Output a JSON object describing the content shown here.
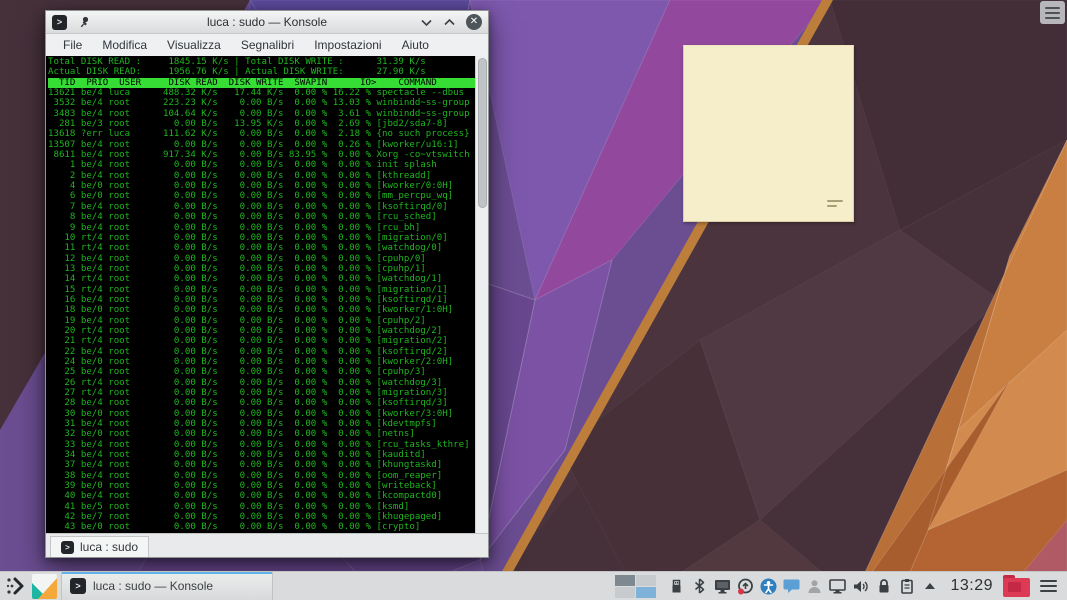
{
  "window": {
    "title": "luca : sudo — Konsole",
    "menu": [
      "File",
      "Modifica",
      "Visualizza",
      "Segnalibri",
      "Impostazioni",
      "Aiuto"
    ],
    "tab_label": "luca : sudo",
    "titlebar_icons": [
      "konsole-icon",
      "pin-icon",
      "minimize-chevron-icon",
      "maximize-chevron-icon",
      "close-icon"
    ],
    "prompt_glyph": ">"
  },
  "terminal": {
    "colors": {
      "background": "#000000",
      "text_green": "#1fb51f",
      "header_bg": "#35dd35",
      "header_text": "#000000"
    },
    "summary_lines": [
      "Total DISK READ :     1845.15 K/s | Total DISK WRITE :      31.39 K/s",
      "Actual DISK READ:     1956.76 K/s | Actual DISK WRITE:      27.90 K/s"
    ],
    "header": "  TID  PRIO  USER     DISK READ  DISK WRITE  SWAPIN      IO>    COMMAND",
    "columns": [
      "TID",
      "PRIO",
      "USER",
      "DISK READ",
      "DISK WRITE",
      "SWAPIN",
      "IO>",
      "COMMAND"
    ],
    "processes": [
      [
        "13621",
        "be/4",
        "luca",
        "488.32 K/s",
        "17.44 K/s",
        "0.00 %",
        "16.22 %",
        "spectacle --dbus"
      ],
      [
        "3532",
        "be/4",
        "root",
        "223.23 K/s",
        "0.00 B/s",
        "0.00 %",
        "13.03 %",
        "winbindd~ss-group"
      ],
      [
        "3483",
        "be/4",
        "root",
        "104.64 K/s",
        "0.00 B/s",
        "0.00 %",
        "3.61 %",
        "winbindd~ss-group"
      ],
      [
        "281",
        "be/3",
        "root",
        "0.00 B/s",
        "13.95 K/s",
        "0.00 %",
        "2.69 %",
        "[jbd2/sda7-8]"
      ],
      [
        "13618",
        "?err",
        "luca",
        "111.62 K/s",
        "0.00 B/s",
        "0.00 %",
        "2.18 %",
        "{no such process}"
      ],
      [
        "13507",
        "be/4",
        "root",
        "0.00 B/s",
        "0.00 B/s",
        "0.00 %",
        "0.26 %",
        "[kworker/u16:1]"
      ],
      [
        "8611",
        "be/4",
        "root",
        "917.34 K/s",
        "0.00 B/s",
        "83.95 %",
        "0.00 %",
        "Xorg -co~vtswitch"
      ],
      [
        "1",
        "be/4",
        "root",
        "0.00 B/s",
        "0.00 B/s",
        "0.00 %",
        "0.00 %",
        "init splash"
      ],
      [
        "2",
        "be/4",
        "root",
        "0.00 B/s",
        "0.00 B/s",
        "0.00 %",
        "0.00 %",
        "[kthreadd]"
      ],
      [
        "4",
        "be/0",
        "root",
        "0.00 B/s",
        "0.00 B/s",
        "0.00 %",
        "0.00 %",
        "[kworker/0:0H]"
      ],
      [
        "6",
        "be/0",
        "root",
        "0.00 B/s",
        "0.00 B/s",
        "0.00 %",
        "0.00 %",
        "[mm_percpu_wq]"
      ],
      [
        "7",
        "be/4",
        "root",
        "0.00 B/s",
        "0.00 B/s",
        "0.00 %",
        "0.00 %",
        "[ksoftirqd/0]"
      ],
      [
        "8",
        "be/4",
        "root",
        "0.00 B/s",
        "0.00 B/s",
        "0.00 %",
        "0.00 %",
        "[rcu_sched]"
      ],
      [
        "9",
        "be/4",
        "root",
        "0.00 B/s",
        "0.00 B/s",
        "0.00 %",
        "0.00 %",
        "[rcu_bh]"
      ],
      [
        "10",
        "rt/4",
        "root",
        "0.00 B/s",
        "0.00 B/s",
        "0.00 %",
        "0.00 %",
        "[migration/0]"
      ],
      [
        "11",
        "rt/4",
        "root",
        "0.00 B/s",
        "0.00 B/s",
        "0.00 %",
        "0.00 %",
        "[watchdog/0]"
      ],
      [
        "12",
        "be/4",
        "root",
        "0.00 B/s",
        "0.00 B/s",
        "0.00 %",
        "0.00 %",
        "[cpuhp/0]"
      ],
      [
        "13",
        "be/4",
        "root",
        "0.00 B/s",
        "0.00 B/s",
        "0.00 %",
        "0.00 %",
        "[cpuhp/1]"
      ],
      [
        "14",
        "rt/4",
        "root",
        "0.00 B/s",
        "0.00 B/s",
        "0.00 %",
        "0.00 %",
        "[watchdog/1]"
      ],
      [
        "15",
        "rt/4",
        "root",
        "0.00 B/s",
        "0.00 B/s",
        "0.00 %",
        "0.00 %",
        "[migration/1]"
      ],
      [
        "16",
        "be/4",
        "root",
        "0.00 B/s",
        "0.00 B/s",
        "0.00 %",
        "0.00 %",
        "[ksoftirqd/1]"
      ],
      [
        "18",
        "be/0",
        "root",
        "0.00 B/s",
        "0.00 B/s",
        "0.00 %",
        "0.00 %",
        "[kworker/1:0H]"
      ],
      [
        "19",
        "be/4",
        "root",
        "0.00 B/s",
        "0.00 B/s",
        "0.00 %",
        "0.00 %",
        "[cpuhp/2]"
      ],
      [
        "20",
        "rt/4",
        "root",
        "0.00 B/s",
        "0.00 B/s",
        "0.00 %",
        "0.00 %",
        "[watchdog/2]"
      ],
      [
        "21",
        "rt/4",
        "root",
        "0.00 B/s",
        "0.00 B/s",
        "0.00 %",
        "0.00 %",
        "[migration/2]"
      ],
      [
        "22",
        "be/4",
        "root",
        "0.00 B/s",
        "0.00 B/s",
        "0.00 %",
        "0.00 %",
        "[ksoftirqd/2]"
      ],
      [
        "24",
        "be/0",
        "root",
        "0.00 B/s",
        "0.00 B/s",
        "0.00 %",
        "0.00 %",
        "[kworker/2:0H]"
      ],
      [
        "25",
        "be/4",
        "root",
        "0.00 B/s",
        "0.00 B/s",
        "0.00 %",
        "0.00 %",
        "[cpuhp/3]"
      ],
      [
        "26",
        "rt/4",
        "root",
        "0.00 B/s",
        "0.00 B/s",
        "0.00 %",
        "0.00 %",
        "[watchdog/3]"
      ],
      [
        "27",
        "rt/4",
        "root",
        "0.00 B/s",
        "0.00 B/s",
        "0.00 %",
        "0.00 %",
        "[migration/3]"
      ],
      [
        "28",
        "be/4",
        "root",
        "0.00 B/s",
        "0.00 B/s",
        "0.00 %",
        "0.00 %",
        "[ksoftirqd/3]"
      ],
      [
        "30",
        "be/0",
        "root",
        "0.00 B/s",
        "0.00 B/s",
        "0.00 %",
        "0.00 %",
        "[kworker/3:0H]"
      ],
      [
        "31",
        "be/4",
        "root",
        "0.00 B/s",
        "0.00 B/s",
        "0.00 %",
        "0.00 %",
        "[kdevtmpfs]"
      ],
      [
        "32",
        "be/0",
        "root",
        "0.00 B/s",
        "0.00 B/s",
        "0.00 %",
        "0.00 %",
        "[netns]"
      ],
      [
        "33",
        "be/4",
        "root",
        "0.00 B/s",
        "0.00 B/s",
        "0.00 %",
        "0.00 %",
        "[rcu_tasks_kthre]"
      ],
      [
        "34",
        "be/4",
        "root",
        "0.00 B/s",
        "0.00 B/s",
        "0.00 %",
        "0.00 %",
        "[kauditd]"
      ],
      [
        "37",
        "be/4",
        "root",
        "0.00 B/s",
        "0.00 B/s",
        "0.00 %",
        "0.00 %",
        "[khungtaskd]"
      ],
      [
        "38",
        "be/4",
        "root",
        "0.00 B/s",
        "0.00 B/s",
        "0.00 %",
        "0.00 %",
        "[oom_reaper]"
      ],
      [
        "39",
        "be/0",
        "root",
        "0.00 B/s",
        "0.00 B/s",
        "0.00 %",
        "0.00 %",
        "[writeback]"
      ],
      [
        "40",
        "be/4",
        "root",
        "0.00 B/s",
        "0.00 B/s",
        "0.00 %",
        "0.00 %",
        "[kcompactd0]"
      ],
      [
        "41",
        "be/5",
        "root",
        "0.00 B/s",
        "0.00 B/s",
        "0.00 %",
        "0.00 %",
        "[ksmd]"
      ],
      [
        "42",
        "be/7",
        "root",
        "0.00 B/s",
        "0.00 B/s",
        "0.00 %",
        "0.00 %",
        "[khugepaged]"
      ],
      [
        "43",
        "be/0",
        "root",
        "0.00 B/s",
        "0.00 B/s",
        "0.00 %",
        "0.00 %",
        "[crypto]"
      ]
    ]
  },
  "panel": {
    "task": {
      "label": "luca : sudo — Konsole",
      "active": true,
      "indicator_color": "#5fb3e6"
    },
    "clock": "13:29",
    "launcher_icons": [
      "app-launcher-icon",
      "kde-app-icon"
    ],
    "tray": [
      "virtual-desktop-pager",
      "device-notifier-icon",
      "bluetooth-icon",
      "screen-share-icon",
      "update-notifier-icon",
      "accessibility-icon",
      "messages-icon",
      "user-idle-icon",
      "display-icon",
      "volume-icon",
      "lock-icon",
      "clipboard-icon",
      "expand-tray-icon",
      "red-folder-icon",
      "panel-menu-icon"
    ]
  },
  "desktop": {
    "note_color": "#f6eeca",
    "toolbox_icon": "desktop-toolbox-icon"
  }
}
